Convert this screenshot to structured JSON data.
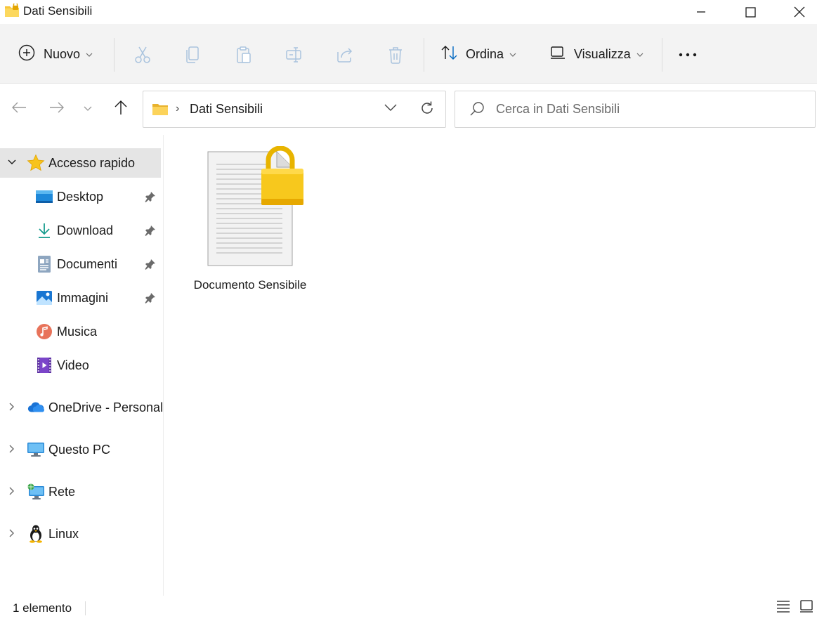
{
  "window": {
    "title": "Dati Sensibili",
    "folder_icon": "folder-locked-icon"
  },
  "toolbar": {
    "new_label": "Nuovo",
    "sort_label": "Ordina",
    "view_label": "Visualizza",
    "more_icon": "more-icon",
    "disabled_icons": [
      "cut-icon",
      "copy-icon",
      "paste-icon",
      "rename-icon",
      "share-icon",
      "delete-icon"
    ]
  },
  "address": {
    "path": "Dati Sensibili",
    "separator": "›"
  },
  "search": {
    "placeholder": "Cerca in Dati Sensibili",
    "value": ""
  },
  "sidebar": {
    "quick_access": {
      "label": "Accesso rapido",
      "expanded": true,
      "selected": true,
      "items": [
        {
          "label": "Desktop",
          "icon": "desktop-icon",
          "pinned": true
        },
        {
          "label": "Download",
          "icon": "download-icon",
          "pinned": true
        },
        {
          "label": "Documenti",
          "icon": "documents-icon",
          "pinned": true
        },
        {
          "label": "Immagini",
          "icon": "pictures-icon",
          "pinned": true
        },
        {
          "label": "Musica",
          "icon": "music-icon",
          "pinned": false
        },
        {
          "label": "Video",
          "icon": "video-icon",
          "pinned": false
        }
      ]
    },
    "roots": [
      {
        "label": "OneDrive - Personal",
        "icon": "onedrive-icon"
      },
      {
        "label": "Questo PC",
        "icon": "pc-icon"
      },
      {
        "label": "Rete",
        "icon": "network-icon"
      },
      {
        "label": "Linux",
        "icon": "linux-icon"
      }
    ]
  },
  "files": [
    {
      "name": "Documento Sensibile",
      "icon": "locked-document-icon"
    }
  ],
  "status": {
    "count": "1 elemento"
  },
  "colors": {
    "accent": "#0067c0",
    "folder": "#f8c63a",
    "lock": "#f5c400",
    "toolbar_bg": "#f3f3f3",
    "selected_bg": "#e5e5e5"
  }
}
